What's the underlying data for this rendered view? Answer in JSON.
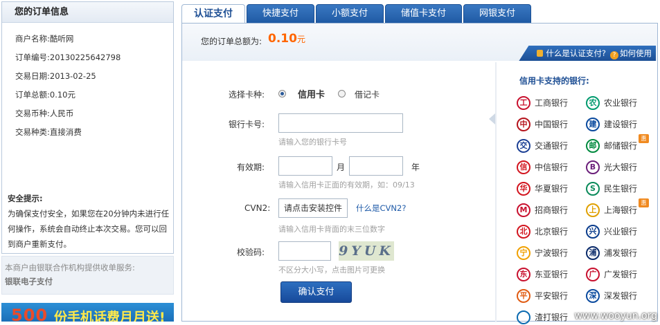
{
  "order": {
    "title": "您的订单信息",
    "rows": [
      {
        "label": "商户名称:",
        "value": "酷听网"
      },
      {
        "label": "订单编号:",
        "value": "20130225642798"
      },
      {
        "label": "交易日期:",
        "value": "2013-02-25"
      },
      {
        "label": "订单总额:",
        "value": "0.10元"
      },
      {
        "label": "交易币种:",
        "value": "人民币"
      },
      {
        "label": "交易种类:",
        "value": "直接消费"
      }
    ]
  },
  "tips": {
    "title": "安全提示:",
    "body": "为确保支付安全，如果您在20分钟内未进行任何操作，系统会自动终止本次交易。您可以回到商户重新支付。"
  },
  "provider": {
    "text": "本商户由银联合作机构提供收单服务:",
    "name": "银联电子支付"
  },
  "banner": {
    "number": "500",
    "text": "份手机话费月月送!"
  },
  "tabs": [
    {
      "label": "认证支付",
      "active": true
    },
    {
      "label": "快捷支付"
    },
    {
      "label": "小额支付"
    },
    {
      "label": "储值卡支付"
    },
    {
      "label": "网银支付"
    }
  ],
  "amount": {
    "label": "您的订单总额为:",
    "value": "0.10",
    "unit": "元"
  },
  "help": {
    "what": "什么是认证支付?",
    "how": "如何使用"
  },
  "form": {
    "card_type_label": "选择卡种:",
    "credit_label": "信用卡",
    "debit_label": "借记卡",
    "card_number_label": "银行卡号:",
    "card_number_hint": "请输入您的银行卡号",
    "expiry_label": "有效期:",
    "month_unit": "月",
    "year_unit": "年",
    "expiry_hint": "请输入信用卡正面的有效期，如：09/13",
    "cvn_label": "CVN2:",
    "cvn_button": "请点击安装控件",
    "cvn_link": "什么是CVN2?",
    "cvn_hint": "请输入信用卡背面的末三位数字",
    "captcha_label": "校验码:",
    "captcha_text": "9YUK",
    "captcha_hint": "不区分大小写，点击图片可更换",
    "submit_label": "确认支付"
  },
  "banks": {
    "title": "信用卡支持的银行:",
    "list": [
      {
        "name": "工商银行",
        "icon": "icbc-icon",
        "color": "#c8102e",
        "glyph": "工"
      },
      {
        "name": "农业银行",
        "icon": "abc-icon",
        "color": "#009a6e",
        "glyph": "农"
      },
      {
        "name": "中国银行",
        "icon": "boc-icon",
        "color": "#b5121b",
        "glyph": "中"
      },
      {
        "name": "建设银行",
        "icon": "ccb-icon",
        "color": "#0a4a9e",
        "glyph": "建"
      },
      {
        "name": "交通银行",
        "icon": "bocom-icon",
        "color": "#1b3f94",
        "glyph": "交"
      },
      {
        "name": "邮储银行",
        "icon": "psbc-icon",
        "color": "#008a3e",
        "glyph": "邮",
        "badge": "惠"
      },
      {
        "name": "中信银行",
        "icon": "citic-icon",
        "color": "#d2141e",
        "glyph": "信"
      },
      {
        "name": "光大银行",
        "icon": "ceb-icon",
        "color": "#6b1f7a",
        "glyph": "B"
      },
      {
        "name": "华夏银行",
        "icon": "hxb-icon",
        "color": "#d2141e",
        "glyph": "华"
      },
      {
        "name": "民生银行",
        "icon": "cmbc-icon",
        "color": "#0a8a5a",
        "glyph": "S"
      },
      {
        "name": "招商银行",
        "icon": "cmb-icon",
        "color": "#c8102e",
        "glyph": "M"
      },
      {
        "name": "上海银行",
        "icon": "bosc-icon",
        "color": "#e0a000",
        "glyph": "上",
        "badge": "惠"
      },
      {
        "name": "北京银行",
        "icon": "bob-icon",
        "color": "#d2141e",
        "glyph": "北"
      },
      {
        "name": "兴业银行",
        "icon": "cib-icon",
        "color": "#0a3c8c",
        "glyph": "兴"
      },
      {
        "name": "宁波银行",
        "icon": "nbcb-icon",
        "color": "#f0a000",
        "glyph": "宁"
      },
      {
        "name": "浦发银行",
        "icon": "spdb-icon",
        "color": "#0a2a6a",
        "glyph": "浦"
      },
      {
        "name": "东亚银行",
        "icon": "bea-icon",
        "color": "#c8102e",
        "glyph": "东"
      },
      {
        "name": "广发银行",
        "icon": "cgb-icon",
        "color": "#c8102e",
        "glyph": "广"
      },
      {
        "name": "平安银行",
        "icon": "pab-icon",
        "color": "#e05a10",
        "glyph": "平"
      },
      {
        "name": "深发银行",
        "icon": "sdb-icon",
        "color": "#0a4a9e",
        "glyph": "深"
      },
      {
        "name": "渣打银行",
        "icon": "scb-icon",
        "color": "#0a6ab0",
        "glyph": ""
      }
    ]
  },
  "watermark": "www.wooyun.org"
}
